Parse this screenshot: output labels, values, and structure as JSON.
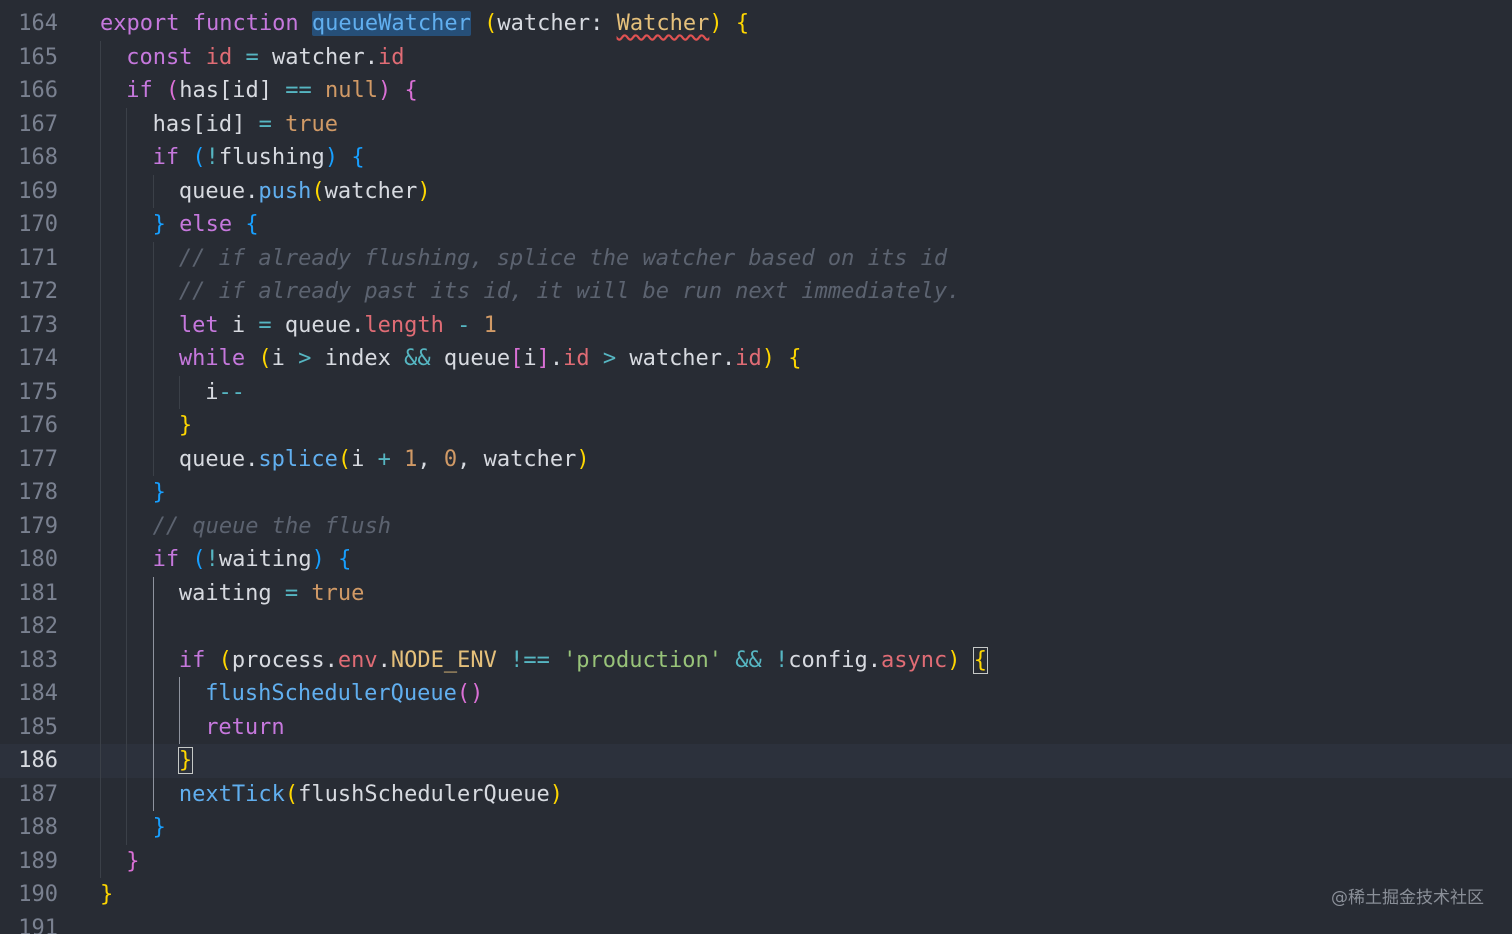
{
  "editor": {
    "active_line": "186",
    "watermark": "@稀土掘金技术社区"
  },
  "lines": [
    {
      "n": "164",
      "tokens": [
        {
          "k": "kw",
          "t": "export function "
        },
        {
          "k": "fn",
          "t": "queueWatcher"
        },
        {
          "k": "p",
          "t": " "
        },
        {
          "k": "b1",
          "t": "("
        },
        {
          "k": "p",
          "t": "watcher: "
        },
        {
          "k": "ty",
          "t": "Watcher"
        },
        {
          "k": "b1",
          "t": ")"
        },
        {
          "k": "p",
          "t": " "
        },
        {
          "k": "b1",
          "t": "{"
        }
      ]
    },
    {
      "n": "165",
      "tokens": [
        {
          "k": "kw",
          "t": "const "
        },
        {
          "k": "var",
          "t": "id"
        },
        {
          "k": "op",
          "t": " = "
        },
        {
          "k": "p",
          "t": "watcher."
        },
        {
          "k": "var",
          "t": "id"
        }
      ]
    },
    {
      "n": "166",
      "tokens": [
        {
          "k": "kw",
          "t": "if "
        },
        {
          "k": "b2",
          "t": "("
        },
        {
          "k": "p",
          "t": "has[id] "
        },
        {
          "k": "op",
          "t": "=="
        },
        {
          "k": "p",
          "t": " "
        },
        {
          "k": "num",
          "t": "null"
        },
        {
          "k": "b2",
          "t": ")"
        },
        {
          "k": "p",
          "t": " "
        },
        {
          "k": "b2",
          "t": "{"
        }
      ]
    },
    {
      "n": "167",
      "tokens": [
        {
          "k": "p",
          "t": "has[id] "
        },
        {
          "k": "op",
          "t": "="
        },
        {
          "k": "p",
          "t": " "
        },
        {
          "k": "num",
          "t": "true"
        }
      ]
    },
    {
      "n": "168",
      "tokens": [
        {
          "k": "kw",
          "t": "if "
        },
        {
          "k": "b3",
          "t": "("
        },
        {
          "k": "op",
          "t": "!"
        },
        {
          "k": "p",
          "t": "flushing"
        },
        {
          "k": "b3",
          "t": ")"
        },
        {
          "k": "p",
          "t": " "
        },
        {
          "k": "b3",
          "t": "{"
        }
      ]
    },
    {
      "n": "169",
      "tokens": [
        {
          "k": "p",
          "t": "queue."
        },
        {
          "k": "fn",
          "t": "push"
        },
        {
          "k": "b1",
          "t": "("
        },
        {
          "k": "p",
          "t": "watcher"
        },
        {
          "k": "b1",
          "t": ")"
        }
      ]
    },
    {
      "n": "170",
      "tokens": [
        {
          "k": "b3",
          "t": "}"
        },
        {
          "k": "kw",
          "t": " else "
        },
        {
          "k": "b3",
          "t": "{"
        }
      ]
    },
    {
      "n": "171",
      "tokens": [
        {
          "k": "cm",
          "t": "// if already flushing, splice the watcher based on its id"
        }
      ]
    },
    {
      "n": "172",
      "tokens": [
        {
          "k": "cm",
          "t": "// if already past its id, it will be run next immediately."
        }
      ]
    },
    {
      "n": "173",
      "tokens": [
        {
          "k": "kw",
          "t": "let "
        },
        {
          "k": "p",
          "t": "i "
        },
        {
          "k": "op",
          "t": "="
        },
        {
          "k": "p",
          "t": " queue."
        },
        {
          "k": "var",
          "t": "length"
        },
        {
          "k": "op",
          "t": " - "
        },
        {
          "k": "num",
          "t": "1"
        }
      ]
    },
    {
      "n": "174",
      "tokens": [
        {
          "k": "kw",
          "t": "while "
        },
        {
          "k": "b1",
          "t": "("
        },
        {
          "k": "p",
          "t": "i "
        },
        {
          "k": "op",
          "t": ">"
        },
        {
          "k": "p",
          "t": " index "
        },
        {
          "k": "op",
          "t": "&&"
        },
        {
          "k": "p",
          "t": " queue"
        },
        {
          "k": "b2",
          "t": "["
        },
        {
          "k": "p",
          "t": "i"
        },
        {
          "k": "b2",
          "t": "]"
        },
        {
          "k": "p",
          "t": "."
        },
        {
          "k": "var",
          "t": "id"
        },
        {
          "k": "op",
          "t": " > "
        },
        {
          "k": "p",
          "t": "watcher."
        },
        {
          "k": "var",
          "t": "id"
        },
        {
          "k": "b1",
          "t": ")"
        },
        {
          "k": "p",
          "t": " "
        },
        {
          "k": "b1",
          "t": "{"
        }
      ]
    },
    {
      "n": "175",
      "tokens": [
        {
          "k": "p",
          "t": "i"
        },
        {
          "k": "op",
          "t": "--"
        }
      ]
    },
    {
      "n": "176",
      "tokens": [
        {
          "k": "b1",
          "t": "}"
        }
      ]
    },
    {
      "n": "177",
      "tokens": [
        {
          "k": "p",
          "t": "queue."
        },
        {
          "k": "fn",
          "t": "splice"
        },
        {
          "k": "b1",
          "t": "("
        },
        {
          "k": "p",
          "t": "i "
        },
        {
          "k": "op",
          "t": "+"
        },
        {
          "k": "p",
          "t": " "
        },
        {
          "k": "num",
          "t": "1"
        },
        {
          "k": "p",
          "t": ", "
        },
        {
          "k": "num",
          "t": "0"
        },
        {
          "k": "p",
          "t": ", watcher"
        },
        {
          "k": "b1",
          "t": ")"
        }
      ]
    },
    {
      "n": "178",
      "tokens": [
        {
          "k": "b3",
          "t": "}"
        }
      ]
    },
    {
      "n": "179",
      "tokens": [
        {
          "k": "cm",
          "t": "// queue the flush"
        }
      ]
    },
    {
      "n": "180",
      "tokens": [
        {
          "k": "kw",
          "t": "if "
        },
        {
          "k": "b3",
          "t": "("
        },
        {
          "k": "op",
          "t": "!"
        },
        {
          "k": "p",
          "t": "waiting"
        },
        {
          "k": "b3",
          "t": ")"
        },
        {
          "k": "p",
          "t": " "
        },
        {
          "k": "b3",
          "t": "{"
        }
      ]
    },
    {
      "n": "181",
      "tokens": [
        {
          "k": "p",
          "t": "waiting "
        },
        {
          "k": "op",
          "t": "="
        },
        {
          "k": "p",
          "t": " "
        },
        {
          "k": "num",
          "t": "true"
        }
      ]
    },
    {
      "n": "182",
      "tokens": []
    },
    {
      "n": "183",
      "tokens": [
        {
          "k": "kw",
          "t": "if "
        },
        {
          "k": "b1",
          "t": "("
        },
        {
          "k": "p",
          "t": "process."
        },
        {
          "k": "var",
          "t": "env"
        },
        {
          "k": "p",
          "t": "."
        },
        {
          "k": "ty",
          "t": "NODE_ENV"
        },
        {
          "k": "op",
          "t": " !== "
        },
        {
          "k": "str",
          "t": "'production'"
        },
        {
          "k": "op",
          "t": " && "
        },
        {
          "k": "op",
          "t": "!"
        },
        {
          "k": "p",
          "t": "config."
        },
        {
          "k": "var",
          "t": "async"
        },
        {
          "k": "b1",
          "t": ")"
        },
        {
          "k": "p",
          "t": " "
        },
        {
          "k": "b1",
          "t": "{"
        }
      ]
    },
    {
      "n": "184",
      "tokens": [
        {
          "k": "fn",
          "t": "flushSchedulerQueue"
        },
        {
          "k": "b2",
          "t": "()"
        }
      ]
    },
    {
      "n": "185",
      "tokens": [
        {
          "k": "kw",
          "t": "return"
        }
      ]
    },
    {
      "n": "186",
      "tokens": [
        {
          "k": "b1",
          "t": "}"
        }
      ]
    },
    {
      "n": "187",
      "tokens": [
        {
          "k": "fn",
          "t": "nextTick"
        },
        {
          "k": "b1",
          "t": "("
        },
        {
          "k": "p",
          "t": "flushSchedulerQueue"
        },
        {
          "k": "b1",
          "t": ")"
        }
      ]
    },
    {
      "n": "188",
      "tokens": [
        {
          "k": "b3",
          "t": "}"
        }
      ]
    },
    {
      "n": "189",
      "tokens": [
        {
          "k": "b2",
          "t": "}"
        }
      ]
    },
    {
      "n": "190",
      "tokens": [
        {
          "k": "b1",
          "t": "}"
        }
      ]
    },
    {
      "n": "191",
      "tokens": []
    }
  ],
  "colors": {
    "background": "#282c34",
    "keyword": "#c678dd",
    "function": "#61afef",
    "variable": "#e06c75",
    "type": "#e5c07b",
    "string": "#98c379",
    "number": "#d19a66",
    "operator": "#56b6c2",
    "comment": "#5c6370"
  }
}
